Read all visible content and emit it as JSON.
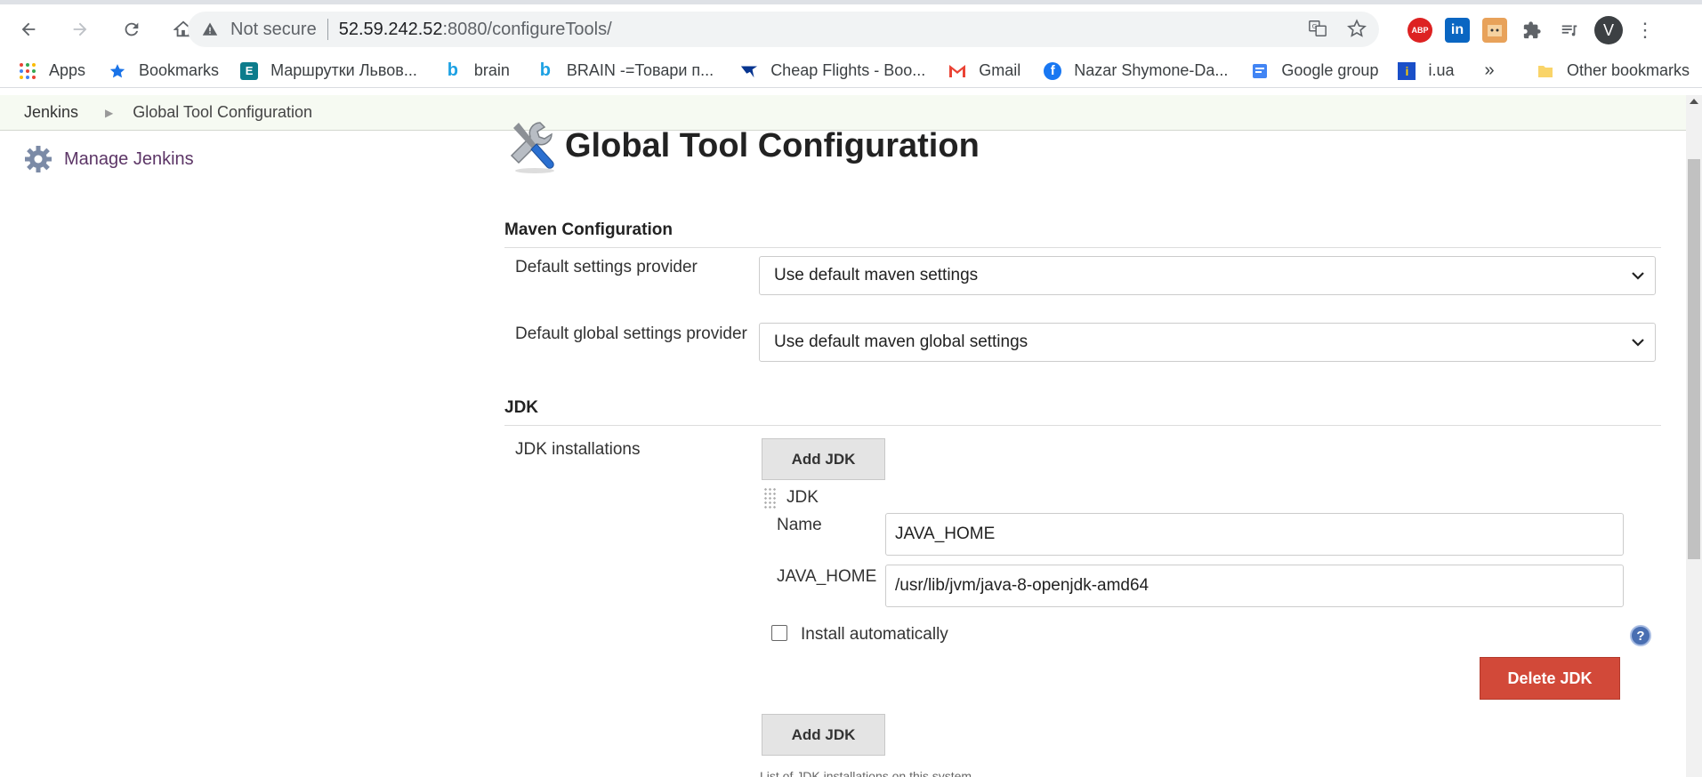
{
  "browser": {
    "omnibox": {
      "security_label": "Not secure",
      "url_host": "52.59.242.52",
      "url_rest": ":8080/configureTools/"
    },
    "avatar_letter": "V",
    "extensions": [
      "abp-icon",
      "linkedin-icon",
      "face-icon",
      "puzzle-icon",
      "playlist-icon"
    ],
    "ext_abp_label": "ABP",
    "ext_linkedin_label": "in"
  },
  "bookmarks": {
    "items": [
      {
        "label": "Apps",
        "icon": "apps-grid-icon"
      },
      {
        "label": "Bookmarks",
        "icon": "star-icon"
      },
      {
        "label": "Маршрутки Львов...",
        "icon": "e-icon"
      },
      {
        "label": "brain",
        "icon": "b-icon"
      },
      {
        "label": "BRAIN -=Товари п...",
        "icon": "b-icon"
      },
      {
        "label": "Cheap Flights - Boo...",
        "icon": "ryanair-icon"
      },
      {
        "label": "Gmail",
        "icon": "gmail-icon"
      },
      {
        "label": "Nazar Shymone-Da...",
        "icon": "facebook-icon"
      },
      {
        "label": "Google group",
        "icon": "group-icon"
      },
      {
        "label": "i.ua",
        "icon": "iua-icon"
      }
    ],
    "more": "»",
    "other": "Other bookmarks"
  },
  "jenkins": {
    "breadcrumbs": [
      "Jenkins",
      "Global Tool Configuration"
    ],
    "side_panel": {
      "manage_label": "Manage Jenkins"
    },
    "page_title": "Global Tool Configuration",
    "maven": {
      "header": "Maven Configuration",
      "default_settings_label": "Default settings provider",
      "default_settings_value": "Use default maven settings",
      "global_settings_label": "Default global settings provider",
      "global_settings_value": "Use default maven global settings"
    },
    "jdk": {
      "header": "JDK",
      "installations_label": "JDK installations",
      "add_button": "Add JDK",
      "entry_title": "JDK",
      "name_label": "Name",
      "name_value": "JAVA_HOME",
      "home_label": "JAVA_HOME",
      "home_value": "/usr/lib/jvm/java-8-openjdk-amd64",
      "install_auto_label": "Install automatically",
      "install_auto_checked": false,
      "delete_button": "Delete JDK",
      "add_button_2": "Add JDK",
      "hint": "List of JDK installations on this system"
    },
    "help_glyph": "?"
  },
  "colors": {
    "delete_button": "#d24939",
    "link_purple": "#5c3566",
    "breadcrumb_bg": "#f6faf2"
  }
}
